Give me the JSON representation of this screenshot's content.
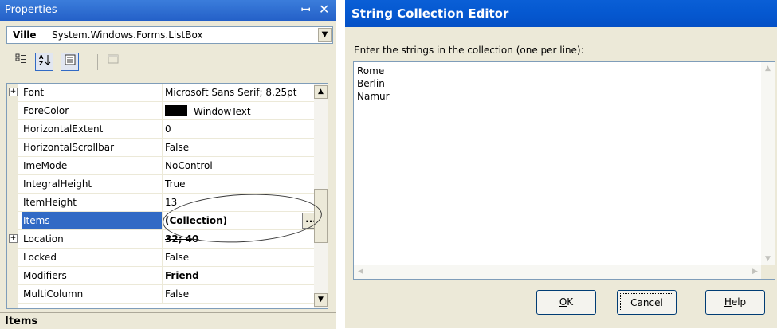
{
  "properties": {
    "title": "Properties",
    "pin_glyph": "ꟷ",
    "close_glyph": "✕",
    "object": {
      "name": "Ville",
      "type": "System.Windows.Forms.ListBox"
    },
    "toolbar_icons": [
      "categorized-icon",
      "alphabetical-icon",
      "properties-icon",
      "events-icon"
    ],
    "rows": [
      {
        "name": "Font",
        "value": "Microsoft Sans Serif; 8,25pt",
        "expandable": true
      },
      {
        "name": "ForeColor",
        "value": "WindowText",
        "swatch": "#000000"
      },
      {
        "name": "HorizontalExtent",
        "value": "0"
      },
      {
        "name": "HorizontalScrollbar",
        "value": "False"
      },
      {
        "name": "ImeMode",
        "value": "NoControl"
      },
      {
        "name": "IntegralHeight",
        "value": "True"
      },
      {
        "name": "ItemHeight",
        "value": "13"
      },
      {
        "name": "Items",
        "value": "(Collection)",
        "bold": true,
        "selected": true
      },
      {
        "name": "Location",
        "value": "32; 40",
        "bold": true,
        "expandable": true
      },
      {
        "name": "Locked",
        "value": "False"
      },
      {
        "name": "Modifiers",
        "value": "Friend",
        "bold": true
      },
      {
        "name": "MultiColumn",
        "value": "False"
      }
    ],
    "ellipsis": "...",
    "description_title": "Items"
  },
  "dialog": {
    "title": "String Collection Editor",
    "prompt": "Enter the strings in the collection (one per line):",
    "lines": [
      "Rome",
      "Berlin",
      "Namur"
    ],
    "buttons": {
      "ok": "OK",
      "cancel": "Cancel",
      "help": "Help"
    }
  },
  "colors": {
    "selection": "#316ac5",
    "titlebar": "#0558d0"
  }
}
